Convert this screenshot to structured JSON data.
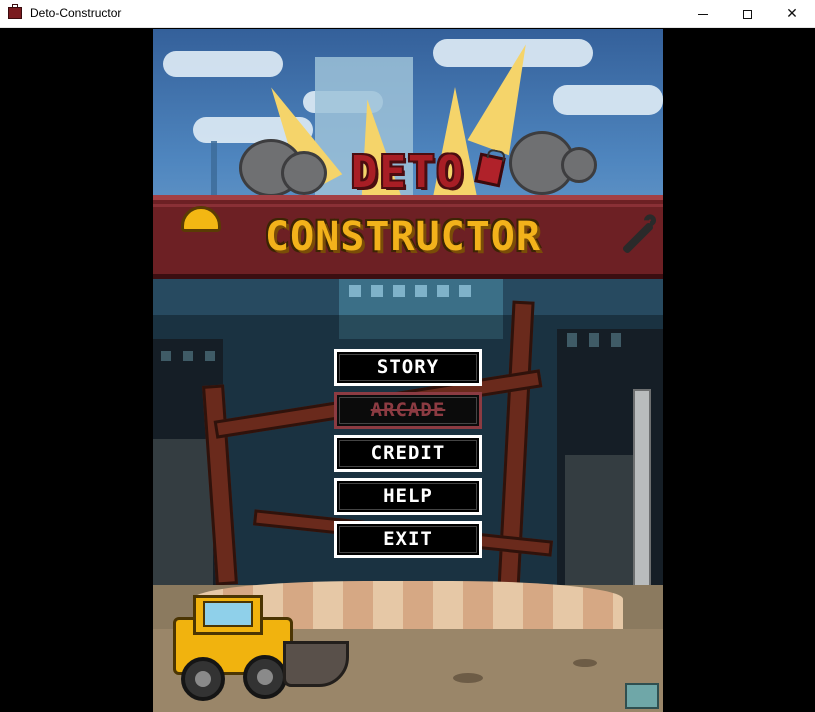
{
  "window": {
    "title": "Deto-Constructor",
    "icon": "dynamite-app-icon",
    "controls": [
      "minimize",
      "maximize",
      "close"
    ]
  },
  "logo": {
    "line1": "DETO",
    "line2": "CONSTRUCTOR"
  },
  "menu": {
    "items": [
      {
        "label": "STORY",
        "enabled": true
      },
      {
        "label": "ARCADE",
        "enabled": false
      },
      {
        "label": "CREDIT",
        "enabled": true
      },
      {
        "label": "HELP",
        "enabled": true
      },
      {
        "label": "EXIT",
        "enabled": true
      }
    ]
  },
  "colors": {
    "menu_text": "#ffffff",
    "menu_disabled": "#8c3b42",
    "logo_red": "#a81e25",
    "logo_gold": "#f2b21b",
    "banner": "#6d2024"
  }
}
